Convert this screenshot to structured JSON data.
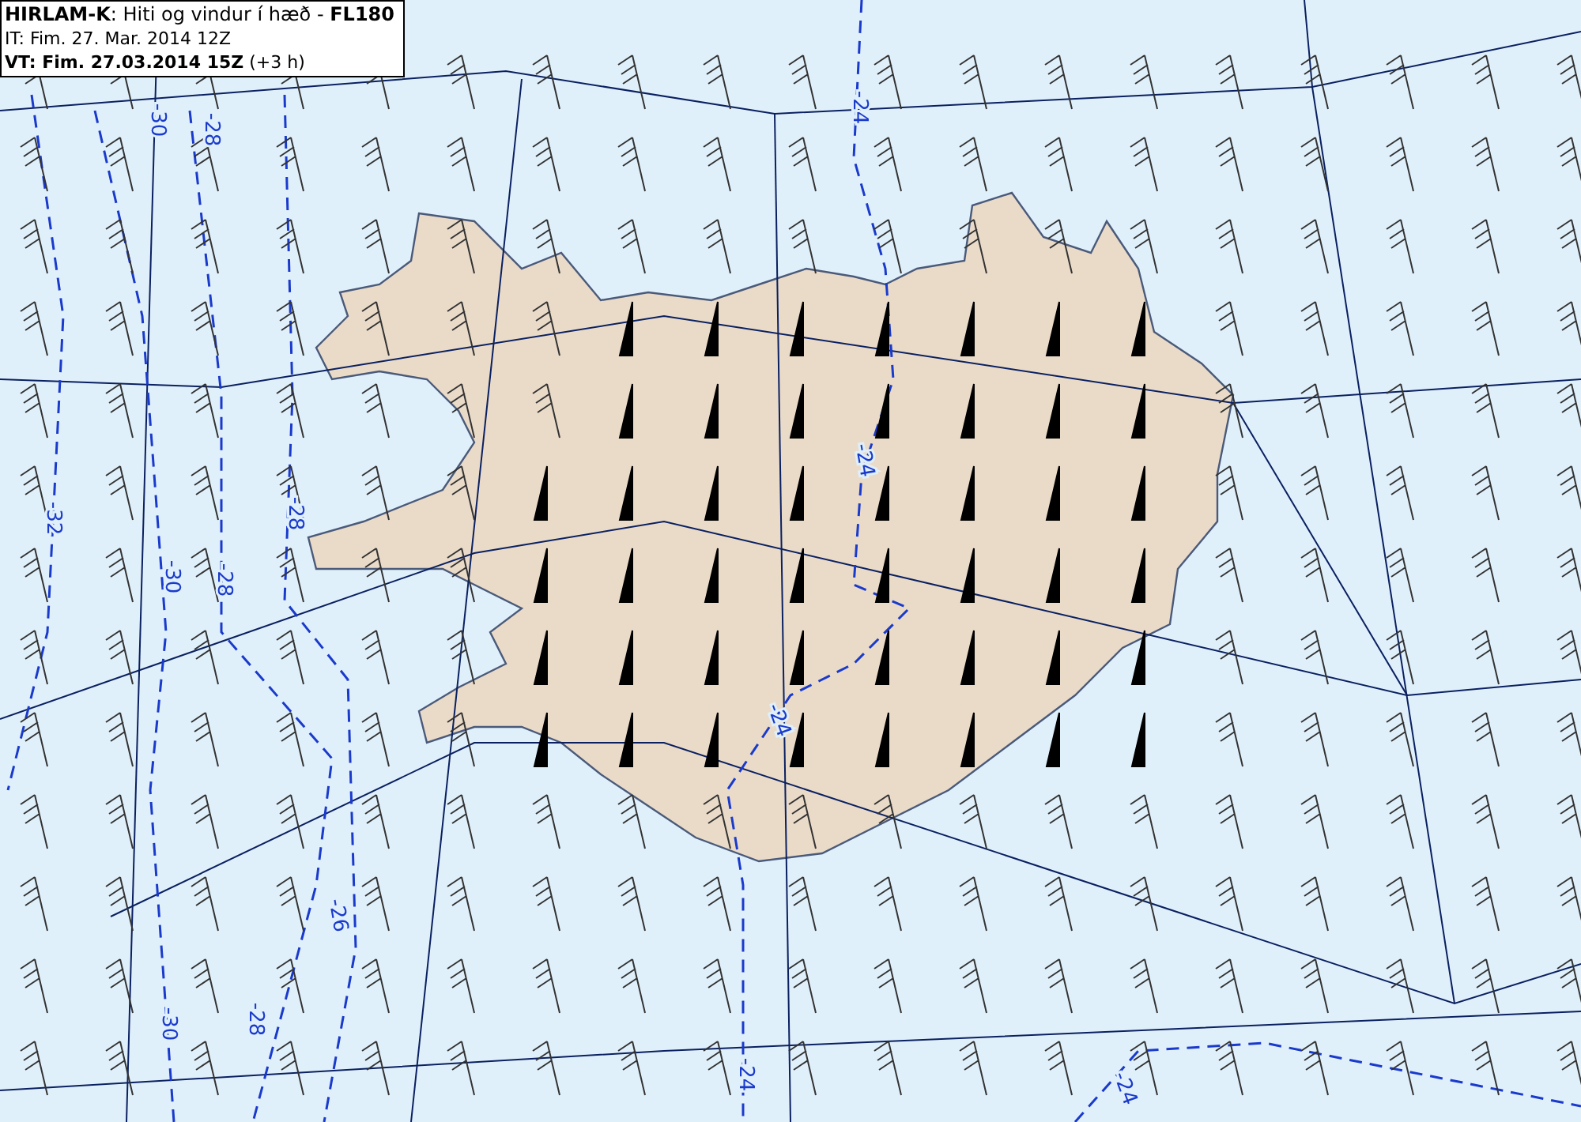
{
  "title_box": {
    "lines": [
      "**HIRLAM-K**: Hiti og vindur í hæð - **FL180**",
      "IT: Fim. 27. Mar. 2014 12Z",
      "**VT: Fim. 27.03.2014 15Z** (+3 h)"
    ]
  },
  "contour_labels": [
    "-24",
    "-30",
    "-28",
    "-32",
    "-28",
    "-30",
    "-28",
    "-24",
    "-24",
    "-26",
    "-30",
    "-28",
    "-24",
    "-24"
  ]
}
